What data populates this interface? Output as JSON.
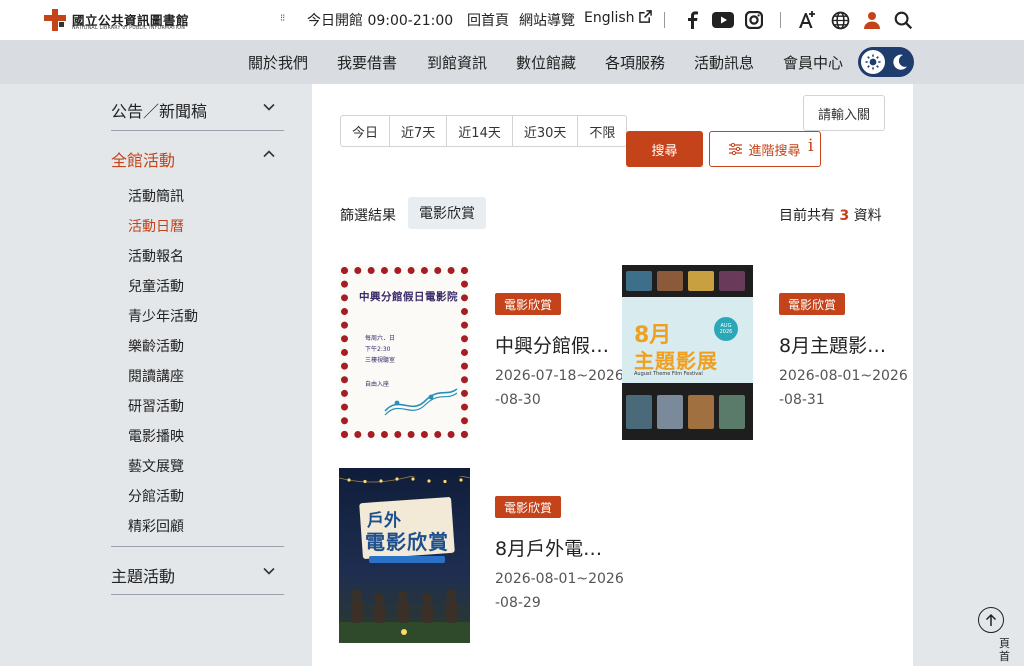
{
  "brand": {
    "name": "國立公共資訊圖書館",
    "subtitle": "NATIONAL LIBRARY of PUBLIC INFORMATION"
  },
  "topbar": {
    "opening_hours": "今日開館 09:00-21:00",
    "home": "回首頁",
    "sitemap": "網站導覽",
    "english": "English"
  },
  "nav": {
    "items": [
      "關於我們",
      "我要借書",
      "到館資訊",
      "數位館藏",
      "各項服務",
      "活動訊息",
      "會員中心"
    ]
  },
  "sidebar": {
    "sections": [
      {
        "label": "公告／新聞稿",
        "expanded": false
      },
      {
        "label": "全館活動",
        "expanded": true,
        "active": true
      },
      {
        "label": "主題活動",
        "expanded": false
      }
    ],
    "sub_items": [
      "活動簡訊",
      "活動日曆",
      "活動報名",
      "兒童活動",
      "青少年活動",
      "樂齡活動",
      "閱讀講座",
      "研習活動",
      "電影播映",
      "藝文展覽",
      "分館活動",
      "精彩回顧"
    ],
    "active_sub": "活動日曆"
  },
  "filters": {
    "ranges": [
      "今日",
      "近7天",
      "近14天",
      "近30天",
      "不限"
    ],
    "login": "請輸入關",
    "search": "搜尋",
    "advanced": "進階搜尋",
    "advanced_info": "i",
    "result_label": "篩選結果",
    "active_filter": "電影欣賞",
    "count_prefix": "目前共有",
    "count": "3",
    "count_suffix": "資料"
  },
  "events": [
    {
      "tag": "電影欣賞",
      "title": "中興分館假…",
      "date": "2026-07-18~2026-08-30",
      "poster": {
        "title": "中興分館假日電影院",
        "line1": "每周六．日",
        "line2": "下午2:30",
        "line3": "三樓視聽室",
        "free": "自由入座"
      }
    },
    {
      "tag": "電影欣賞",
      "title": "8月主題影…",
      "date": "2026-08-01~2026-08-31",
      "poster": {
        "title1": "8月",
        "title2": "主題影展",
        "subtitle": "August Theme Film Festival",
        "badge": "AUG",
        "year": "2026"
      }
    },
    {
      "tag": "電影欣賞",
      "title": "8月戶外電…",
      "date": "2026-08-01~2026-08-29",
      "poster": {
        "title1": "戶外",
        "title2": "電影欣賞"
      }
    }
  ],
  "back_to_top": "頁首",
  "colors": {
    "accent": "#c4431a",
    "nav_bg": "#d9dde2",
    "toggle_bg": "#1e3c6e"
  }
}
